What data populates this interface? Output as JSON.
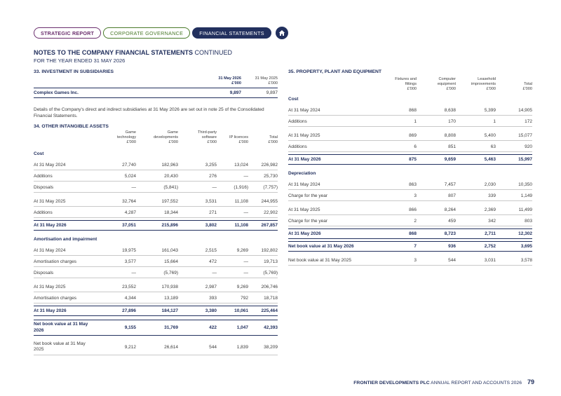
{
  "nav": {
    "strategic": "STRATEGIC REPORT",
    "governance": "CORPORATE GOVERNANCE",
    "financial": "FINANCIAL STATEMENTS",
    "home_icon": "home-icon"
  },
  "heading": {
    "title": "NOTES TO THE COMPANY FINANCIAL STATEMENTS",
    "continued": "CONTINUED",
    "subtitle": "FOR THE YEAR ENDED 31 MAY 2026"
  },
  "s33": {
    "title": "33. INVESTMENT IN SUBSIDIARIES",
    "col1": [
      "31 May 2026",
      "£'000"
    ],
    "col2": [
      "31 May 2025",
      "£'000"
    ],
    "row": {
      "label": "Complex Games Inc.",
      "v1": "9,897",
      "v2": "9,897"
    },
    "note": "Details of the Company's direct and indirect subsidiaries at 31 May 2026 are set out in note 25 of the Consolidated Financial Statements."
  },
  "s34": {
    "title": "34. OTHER INTANGIBLE ASSETS",
    "headers": [
      [
        "Game",
        "technology",
        "£'000"
      ],
      [
        "Game",
        "developments",
        "£'000"
      ],
      [
        "Third-party",
        "software",
        "£'000"
      ],
      [
        "IP licences",
        "£'000"
      ],
      [
        "Total",
        "£'000"
      ]
    ],
    "cost_label": "Cost",
    "cost": [
      {
        "label": "At 31 May 2024",
        "v": [
          "27,740",
          "182,963",
          "3,255",
          "13,024",
          "226,982"
        ]
      },
      {
        "label": "Additions",
        "v": [
          "5,024",
          "20,430",
          "276",
          "—",
          "25,730"
        ]
      },
      {
        "label": "Disposals",
        "v": [
          "—",
          "(5,841)",
          "—",
          "(1,916)",
          "(7,757)"
        ]
      },
      {
        "label": "At 31 May 2025",
        "v": [
          "32,764",
          "197,552",
          "3,531",
          "11,108",
          "244,955"
        ]
      },
      {
        "label": "Additions",
        "v": [
          "4,287",
          "18,344",
          "271",
          "—",
          "22,902"
        ]
      }
    ],
    "cost_total": {
      "label": "At 31 May 2026",
      "v": [
        "37,051",
        "215,896",
        "3,802",
        "11,108",
        "267,857"
      ]
    },
    "amort_label": "Amortisation and impairment",
    "amort": [
      {
        "label": "At 31 May 2024",
        "v": [
          "19,975",
          "161,043",
          "2,515",
          "9,269",
          "192,802"
        ]
      },
      {
        "label": "Amortisation charges",
        "v": [
          "3,577",
          "15,664",
          "472",
          "—",
          "19,713"
        ]
      },
      {
        "label": "Disposals",
        "v": [
          "—",
          "(5,769)",
          "—",
          "—",
          "(5,769)"
        ]
      },
      {
        "label": "At 31 May 2025",
        "v": [
          "23,552",
          "170,938",
          "2,987",
          "9,269",
          "206,746"
        ]
      },
      {
        "label": "Amortisation charges",
        "v": [
          "4,344",
          "13,189",
          "393",
          "792",
          "18,718"
        ]
      }
    ],
    "amort_total": {
      "label": "At 31 May 2026",
      "v": [
        "27,896",
        "184,127",
        "3,380",
        "10,061",
        "225,464"
      ]
    },
    "nbv_2026": {
      "label1": "Net book value at 31 May",
      "label2": "2026",
      "v": [
        "9,155",
        "31,769",
        "422",
        "1,047",
        "42,393"
      ]
    },
    "nbv_2025": {
      "label1": "Net book value at 31 May",
      "label2": "2025",
      "v": [
        "9,212",
        "26,614",
        "544",
        "1,839",
        "38,209"
      ]
    }
  },
  "s35": {
    "title": "35. PROPERTY, PLANT AND EQUIPMENT",
    "headers": [
      [
        "Fixtures and",
        "fittings",
        "£'000"
      ],
      [
        "Computer",
        "equipment",
        "£'000"
      ],
      [
        "Leasehold",
        "improvements",
        "£'000"
      ],
      [
        "Total",
        "£'000"
      ]
    ],
    "cost_label": "Cost",
    "cost": [
      {
        "label": "At 31 May 2024",
        "v": [
          "868",
          "8,638",
          "5,399",
          "14,905"
        ]
      },
      {
        "label": "Additions",
        "v": [
          "1",
          "170",
          "1",
          "172"
        ]
      },
      {
        "label": "At 31 May 2025",
        "v": [
          "869",
          "8,808",
          "5,400",
          "15,077"
        ]
      },
      {
        "label": "Additions",
        "v": [
          "6",
          "851",
          "63",
          "920"
        ]
      }
    ],
    "cost_total": {
      "label": "At 31 May 2026",
      "v": [
        "875",
        "9,659",
        "5,463",
        "15,997"
      ]
    },
    "dep_label": "Depreciation",
    "dep": [
      {
        "label": "At 31 May 2024",
        "v": [
          "863",
          "7,457",
          "2,030",
          "10,350"
        ]
      },
      {
        "label": "Charge for the year",
        "v": [
          "3",
          "807",
          "339",
          "1,149"
        ]
      },
      {
        "label": "At 31 May 2025",
        "v": [
          "866",
          "8,264",
          "2,369",
          "11,499"
        ]
      },
      {
        "label": "Charge for the year",
        "v": [
          "2",
          "459",
          "342",
          "803"
        ]
      }
    ],
    "dep_total": {
      "label": "At 31 May 2026",
      "v": [
        "868",
        "8,723",
        "2,711",
        "12,302"
      ]
    },
    "nbv_2026": {
      "label": "Net book value at 31 May 2026",
      "v": [
        "7",
        "936",
        "2,752",
        "3,695"
      ]
    },
    "nbv_2025": {
      "label": "Net book value at 31 May 2025",
      "v": [
        "3",
        "544",
        "3,031",
        "3,578"
      ]
    }
  },
  "footer": {
    "company": "FRONTIER DEVELOPMENTS PLC",
    "report": "ANNUAL REPORT AND ACCOUNTS 2026",
    "page": "79"
  }
}
